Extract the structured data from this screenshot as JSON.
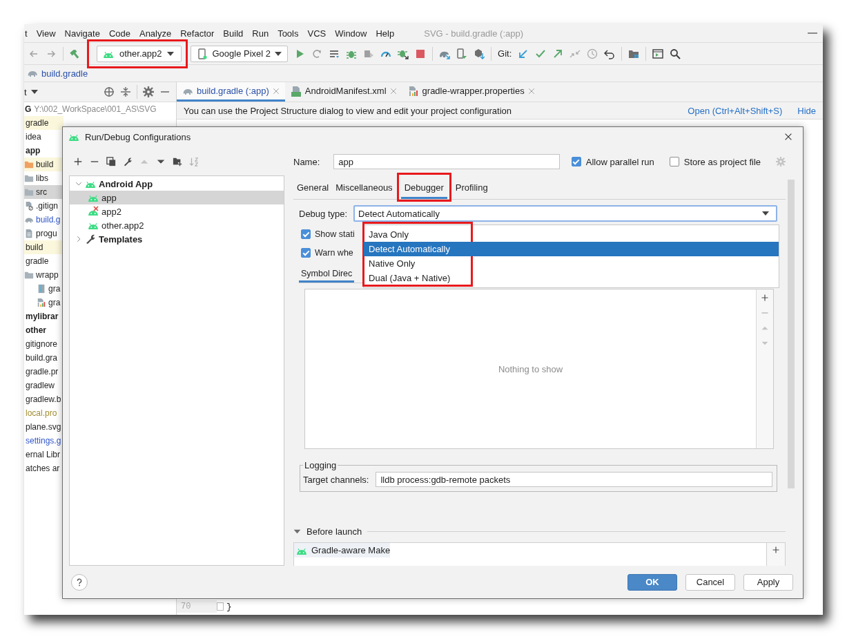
{
  "menu_bar": {
    "items": [
      "t",
      "View",
      "Navigate",
      "Code",
      "Analyze",
      "Refactor",
      "Build",
      "Run",
      "Tools",
      "VCS",
      "Window",
      "Help"
    ],
    "title": "SVG - build.gradle (:app)"
  },
  "toolbar": {
    "run_config": {
      "label": "other.app2",
      "highlighted": true
    },
    "device": {
      "label": "Google Pixel 2"
    },
    "vcs_label": "Git:"
  },
  "breadcrumb": "build.gradle",
  "project_panel": {
    "title": "t",
    "root": {
      "name": "G",
      "path": "Y:\\002_WorkSpace\\001_AS\\SVG"
    },
    "tree": [
      {
        "label": "gradle",
        "kind": "excluded",
        "selected": false
      },
      {
        "label": "idea",
        "selected": false
      },
      {
        "label": "app",
        "kind": "module",
        "selected": false,
        "children": [
          {
            "label": "build",
            "kind": "excluded-folder",
            "selected": false
          },
          {
            "label": "libs",
            "kind": "folder",
            "selected": false
          },
          {
            "label": "src",
            "kind": "folder",
            "selected": true
          },
          {
            "label": ".gitign",
            "kind": "ignore-file",
            "selected": false
          },
          {
            "label": "build.g",
            "kind": "gradle-file",
            "color": "#2f55c8",
            "selected": false
          },
          {
            "label": "progu",
            "kind": "text-file",
            "selected": false
          }
        ]
      },
      {
        "label": "build",
        "kind": "excluded",
        "selected": false
      },
      {
        "label": "gradle",
        "selected": false,
        "children": [
          {
            "label": "wrapp",
            "kind": "folder",
            "selected": false,
            "children": [
              {
                "label": "gra",
                "kind": "archive-file",
                "selected": false
              },
              {
                "label": "gra",
                "kind": "properties-file",
                "selected": false
              }
            ]
          }
        ]
      },
      {
        "label": "mylibrar",
        "kind": "module",
        "selected": false
      },
      {
        "label": "other",
        "kind": "module",
        "selected": false
      },
      {
        "label": "gitignore",
        "selected": false
      },
      {
        "label": "build.gra",
        "selected": false
      },
      {
        "label": "gradle.pr",
        "selected": false
      },
      {
        "label": "gradlew",
        "selected": false
      },
      {
        "label": "gradlew.b",
        "selected": false
      },
      {
        "label": "local.pro",
        "color": "#a08d2f",
        "selected": false
      },
      {
        "label": "plane.svg",
        "selected": false
      },
      {
        "label": "settings.g",
        "color": "#2f55c8",
        "selected": false
      },
      {
        "label": "ernal Libr",
        "selected": false
      },
      {
        "label": "atches ar",
        "selected": false
      }
    ]
  },
  "editor": {
    "tabs": [
      {
        "label": "build.gradle (:app)",
        "kind": "gradle-file",
        "selected": true
      },
      {
        "label": "AndroidManifest.xml",
        "kind": "manifest-file",
        "selected": false
      },
      {
        "label": "gradle-wrapper.properties",
        "kind": "properties-file",
        "selected": false
      }
    ],
    "notification": {
      "text": "You can use the Project Structure dialog to view and edit your project configuration",
      "links": [
        "Open (Ctrl+Alt+Shift+S)",
        "Hide"
      ]
    },
    "lines": [
      {
        "number": "70",
        "code": "}"
      }
    ]
  },
  "dialog": {
    "title": "Run/Debug Configurations",
    "tree": [
      {
        "label": "Android App",
        "kind": "group",
        "expanded": true,
        "selected": false,
        "children": [
          {
            "label": "app",
            "kind": "config",
            "selected": true
          },
          {
            "label": "app2",
            "kind": "config-error",
            "selected": false
          },
          {
            "label": "other.app2",
            "kind": "config",
            "selected": false
          }
        ]
      },
      {
        "label": "Templates",
        "kind": "templates",
        "expanded": false,
        "selected": false
      }
    ],
    "name_label": "Name:",
    "name_value": "app",
    "options": [
      {
        "label": "Allow parallel run",
        "checked": true
      },
      {
        "label": "Store as project file",
        "checked": false
      }
    ],
    "tabs": [
      {
        "label": "General",
        "selected": false,
        "highlighted": false
      },
      {
        "label": "Miscellaneous",
        "selected": false,
        "highlighted": false
      },
      {
        "label": "Debugger",
        "selected": true,
        "highlighted": true
      },
      {
        "label": "Profiling",
        "selected": false,
        "highlighted": false
      }
    ],
    "debug_type": {
      "label": "Debug type:",
      "value": "Detect Automatically",
      "highlighted": true,
      "options": [
        {
          "label": "Java Only",
          "selected": false
        },
        {
          "label": "Detect Automatically",
          "selected": true
        },
        {
          "label": "Native Only",
          "selected": false
        },
        {
          "label": "Dual (Java + Native)",
          "selected": false
        }
      ]
    },
    "checks": [
      {
        "label": "Show stati",
        "checked": true
      },
      {
        "label": "Warn whe",
        "checked": true
      }
    ],
    "sub_tabs": [
      {
        "label": "Symbol Direc",
        "selected": true
      }
    ],
    "empty_text": "Nothing to show",
    "logging": {
      "title": "Logging",
      "label": "Target channels:",
      "value": "lldb process:gdb-remote packets"
    },
    "before_launch": {
      "title": "Before launch",
      "expanded": true,
      "tasks": [
        "Gradle-aware Make"
      ]
    },
    "buttons": [
      {
        "label": "OK",
        "kind": "default"
      },
      {
        "label": "Cancel",
        "kind": "normal"
      },
      {
        "label": "Apply",
        "kind": "normal"
      }
    ]
  }
}
